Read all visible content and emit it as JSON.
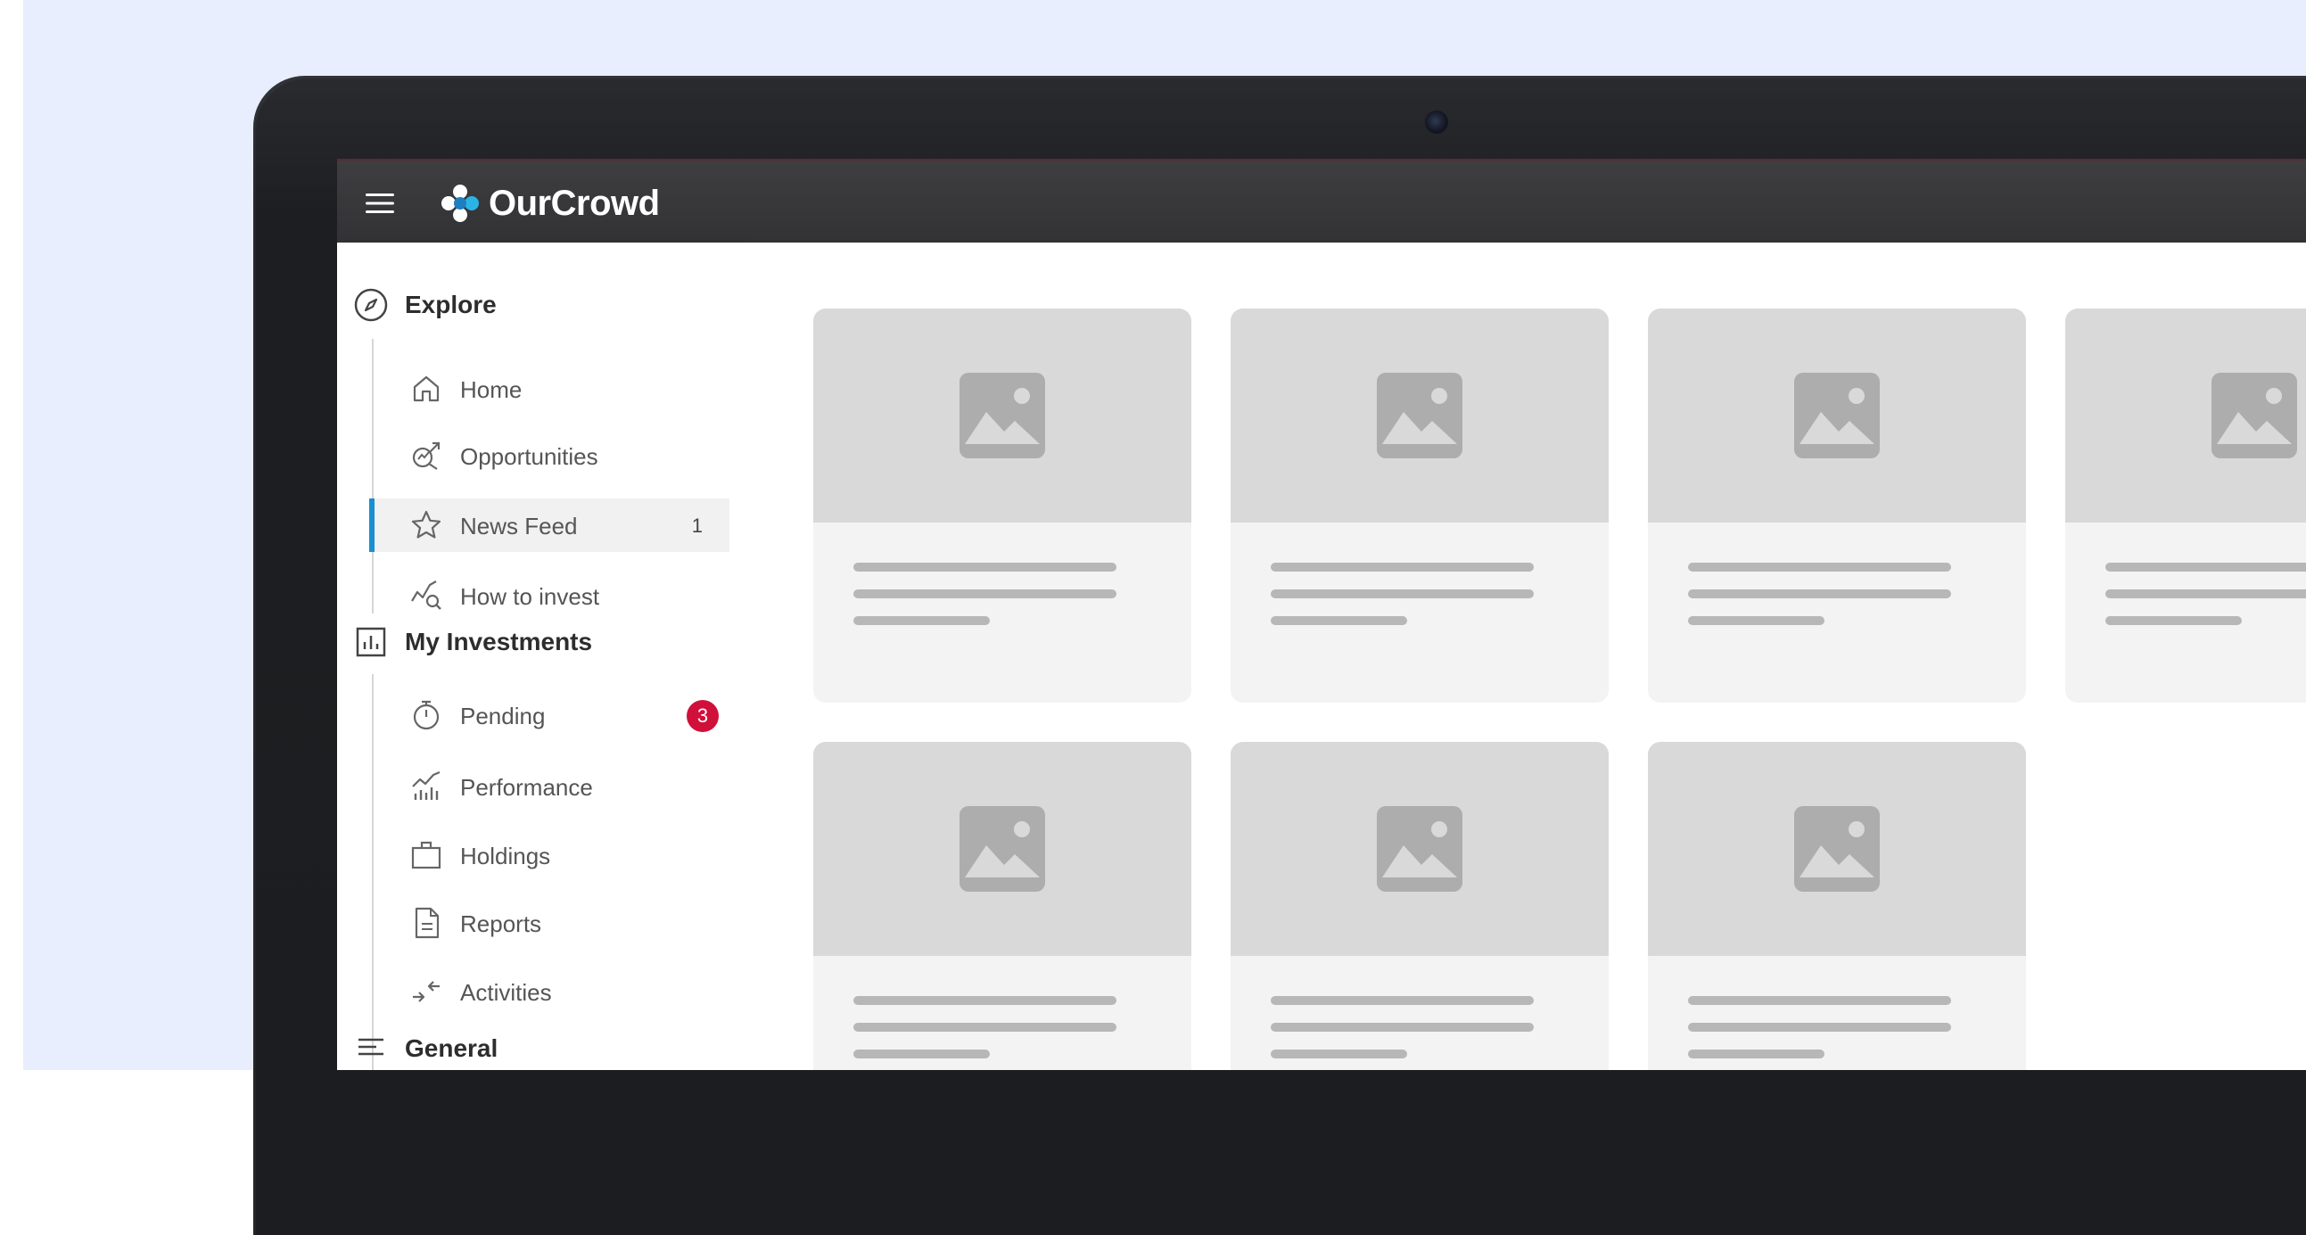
{
  "app": {
    "brand": "OurCrowd",
    "brand_colors": {
      "accent": "#1a8fd0",
      "badge": "#d0103a",
      "topbar": "#353537"
    }
  },
  "topbar": {
    "menu_icon": "hamburger-menu-icon",
    "logo_icon": "ourcrowd-logo-icon"
  },
  "sidebar": {
    "sections": [
      {
        "label": "Explore",
        "icon": "compass-icon",
        "items": [
          {
            "label": "Home",
            "icon": "home-icon"
          },
          {
            "label": "Opportunities",
            "icon": "opportunities-icon"
          },
          {
            "label": "News Feed",
            "icon": "star-icon",
            "count": "1",
            "active": true
          },
          {
            "label": "How to invest",
            "icon": "chart-search-icon"
          }
        ]
      },
      {
        "label": "My Investments",
        "icon": "bar-chart-icon",
        "items": [
          {
            "label": "Pending",
            "icon": "stopwatch-icon",
            "badge": "3"
          },
          {
            "label": "Performance",
            "icon": "performance-icon"
          },
          {
            "label": "Holdings",
            "icon": "briefcase-icon"
          },
          {
            "label": "Reports",
            "icon": "document-icon"
          },
          {
            "label": "Activities",
            "icon": "arrows-icon"
          }
        ]
      },
      {
        "label": "General",
        "icon": "list-icon"
      }
    ]
  },
  "content": {
    "placeholder_cards": [
      {
        "kind": "loading-placeholder",
        "icon": "image-placeholder-icon"
      },
      {
        "kind": "loading-placeholder",
        "icon": "image-placeholder-icon"
      },
      {
        "kind": "loading-placeholder",
        "icon": "image-placeholder-icon"
      },
      {
        "kind": "loading-placeholder",
        "icon": "image-placeholder-icon"
      },
      {
        "kind": "loading-placeholder",
        "icon": "image-placeholder-icon"
      },
      {
        "kind": "loading-placeholder",
        "icon": "image-placeholder-icon"
      },
      {
        "kind": "loading-placeholder",
        "icon": "image-placeholder-icon"
      }
    ]
  }
}
